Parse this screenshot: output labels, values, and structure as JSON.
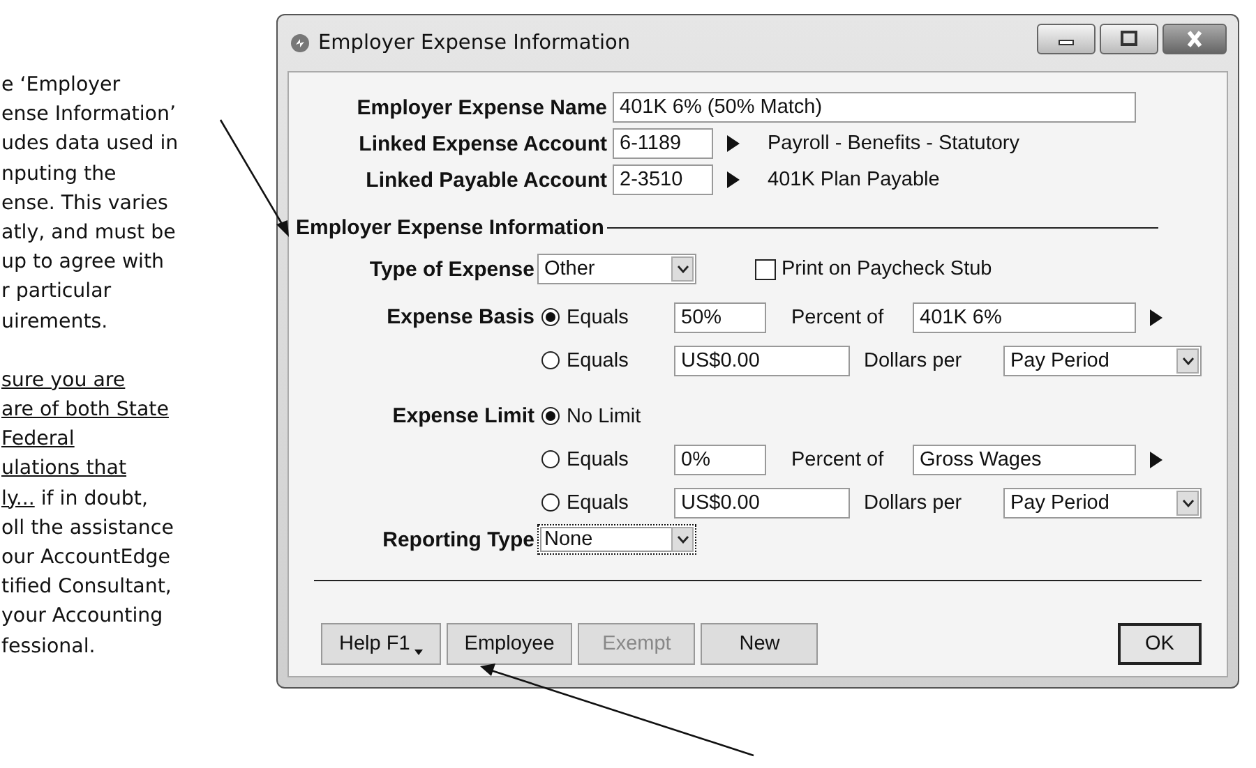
{
  "annotation": {
    "paragraphs": [
      {
        "lines": [
          [
            {
              "text": "e ‘Employer",
              "underlined": false
            }
          ],
          [
            {
              "text": "ense Information’",
              "underlined": false
            }
          ],
          [
            {
              "text": "udes data used in",
              "underlined": false
            }
          ],
          [
            {
              "text": "nputing the",
              "underlined": false
            }
          ],
          [
            {
              "text": "ense. This varies",
              "underlined": false
            }
          ],
          [
            {
              "text": "atly, and must be",
              "underlined": false
            }
          ],
          [
            {
              "text": "up to agree with",
              "underlined": false
            }
          ],
          [
            {
              "text": "r particular",
              "underlined": false
            }
          ],
          [
            {
              "text": "uirements.",
              "underlined": false
            }
          ]
        ]
      },
      {
        "lines": [
          [
            {
              "text": "sure you are",
              "underlined": true
            }
          ],
          [
            {
              "text": "are of both State",
              "underlined": true
            }
          ],
          [
            {
              "text": "Federal",
              "underlined": true
            }
          ],
          [
            {
              "text": "ulations that",
              "underlined": true
            }
          ],
          [
            {
              "text": "ly...",
              "underlined": true
            },
            {
              "text": " if in doubt,",
              "underlined": false
            }
          ],
          [
            {
              "text": "oll the assistance",
              "underlined": false
            }
          ],
          [
            {
              "text": "our AccountEdge",
              "underlined": false
            }
          ],
          [
            {
              "text": "tified Consultant,",
              "underlined": false
            }
          ],
          [
            {
              "text": "your Accounting",
              "underlined": false
            }
          ],
          [
            {
              "text": "fessional.",
              "underlined": false
            }
          ]
        ]
      }
    ]
  },
  "window": {
    "title": "Employer Expense Information"
  },
  "expense_name": {
    "label": "Employer Expense Name",
    "value": "401K 6% (50% Match)"
  },
  "linked_accounts": [
    {
      "label": "Linked Expense Account",
      "value": "6-1189",
      "description": "Payroll - Benefits - Statutory"
    },
    {
      "label": "Linked Payable Account",
      "value": "2-3510",
      "description": "401K Plan Payable"
    }
  ],
  "section_title": "Employer Expense Information",
  "type_of_expense": {
    "label": "Type of Expense",
    "value": "Other",
    "print_on_stub": {
      "label": "Print on Paycheck Stub",
      "checked": false
    }
  },
  "groups": [
    {
      "label": "Expense Basis",
      "options": [
        {
          "kind": "percent",
          "label": "Equals",
          "selected": true,
          "value": "50%",
          "unit": "Percent of",
          "target": "401K 6%"
        },
        {
          "kind": "dollars",
          "label": "Equals",
          "selected": false,
          "value": "US$0.00",
          "unit": "Dollars per",
          "target": "Pay Period"
        }
      ]
    },
    {
      "label": "Expense Limit",
      "options": [
        {
          "kind": "plain",
          "label": "No Limit",
          "selected": true
        },
        {
          "kind": "percent",
          "label": "Equals",
          "selected": false,
          "value": "0%",
          "unit": "Percent of",
          "target": "Gross Wages"
        },
        {
          "kind": "dollars",
          "label": "Equals",
          "selected": false,
          "value": "US$0.00",
          "unit": "Dollars per",
          "target": "Pay Period"
        }
      ]
    }
  ],
  "reporting_type": {
    "label": "Reporting Type",
    "value": "None",
    "focused": true
  },
  "buttons": [
    {
      "label": "Help F1",
      "disabled": false,
      "menu": true
    },
    {
      "label": "Employee",
      "disabled": false,
      "menu": false
    },
    {
      "label": "Exempt",
      "disabled": true,
      "menu": false
    },
    {
      "label": "New",
      "disabled": false,
      "menu": false
    }
  ],
  "ok_button": "OK"
}
